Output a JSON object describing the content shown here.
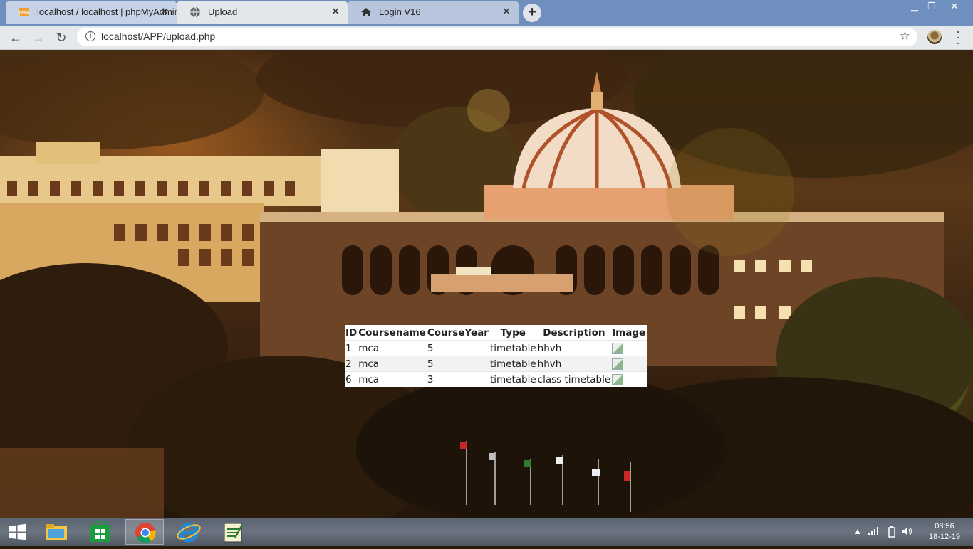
{
  "browser": {
    "tabs": [
      {
        "title": "localhost / localhost | phpMyAdmin",
        "icon": "phpmyadmin-icon"
      },
      {
        "title": "Upload",
        "icon": "globe-icon",
        "active": true
      },
      {
        "title": "Login V16",
        "icon": "home-icon"
      }
    ],
    "url": "localhost/APP/upload.php",
    "window_controls": {
      "minimize": "▁",
      "maximize": "❐",
      "close": "✕"
    }
  },
  "table": {
    "headers": [
      "ID",
      "Coursename",
      "CourseYear",
      "Type",
      "Description",
      "Image"
    ],
    "rows": [
      {
        "id": "1",
        "coursename": "mca",
        "courseyear": "5",
        "type": "timetable",
        "description": "hhvh"
      },
      {
        "id": "2",
        "coursename": "mca",
        "courseyear": "5",
        "type": "timetable",
        "description": "hhvh"
      },
      {
        "id": "6",
        "coursename": "mca",
        "courseyear": "3",
        "type": "timetable",
        "description": "class timetable"
      }
    ]
  },
  "taskbar": {
    "apps": [
      "start-button",
      "file-explorer-icon",
      "store-icon",
      "chrome-icon",
      "internet-explorer-icon",
      "notepad-icon"
    ],
    "time": "08:56",
    "date": "18-12-19"
  },
  "colors": {
    "tabstrip": "#6f8fbf",
    "toolbar": "#e6e9ec",
    "taskbar": "#5a6470"
  }
}
